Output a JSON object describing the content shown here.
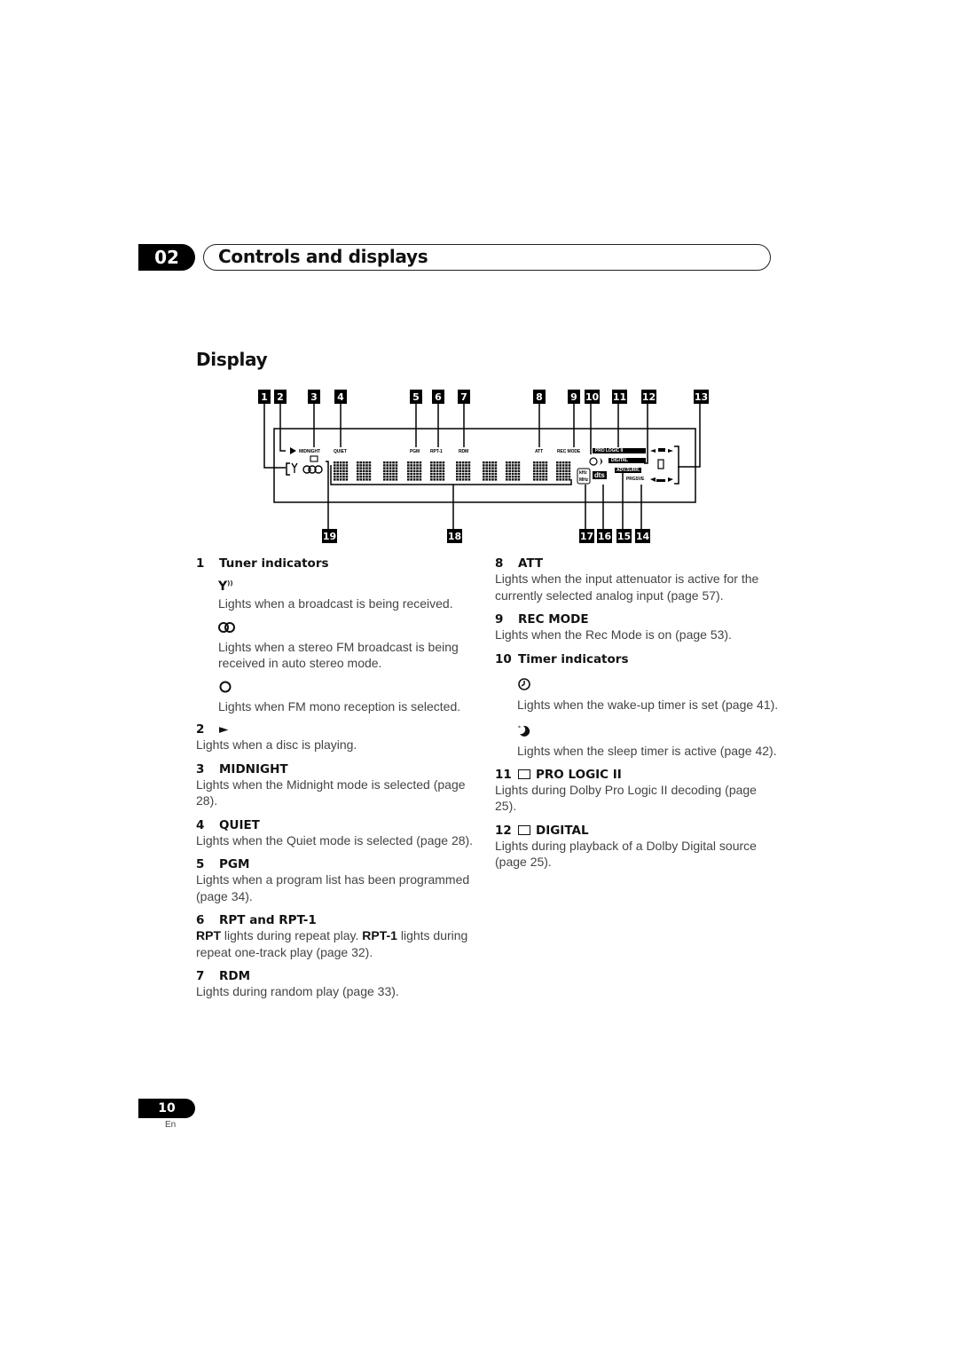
{
  "chapter": {
    "number": "02",
    "title": "Controls and displays"
  },
  "section_title": "Display",
  "diagram": {
    "top_callouts": [
      "1",
      "2",
      "3",
      "4",
      "5",
      "6",
      "7",
      "8",
      "9",
      "10",
      "11",
      "12",
      "13"
    ],
    "bottom_callouts": [
      "19",
      "18",
      "17",
      "16",
      "15",
      "14"
    ],
    "lcd_labels": {
      "midnight": "MIDNIGHT",
      "quiet": "QUIET",
      "pgm": "PGM",
      "rpt1": "RPT-1",
      "rdm": "RDM",
      "att": "ATT",
      "rec_mode": "REC MODE",
      "pro_logic": "PRO LOGIC II",
      "digital": "DIGITAL",
      "adv_surr": "ADV.SURR.",
      "prgsve": "PRGSVE",
      "khz": "kHz",
      "mhz": "MHz",
      "dts": "dts"
    },
    "icons": [
      "play-icon",
      "antenna-icon",
      "stereo-icon",
      "video-camera-icon",
      "clock-icon",
      "sleep-moon-icon",
      "dolby-icon",
      "speaker-layout-icon"
    ]
  },
  "items_left": [
    {
      "num": "1",
      "title": "Tuner indicators",
      "subitems": [
        {
          "icon": "antenna-icon",
          "glyph": "Y",
          "text": "Lights when a broadcast is being received."
        },
        {
          "icon": "stereo-icon",
          "glyph": "OO",
          "text": "Lights when a stereo FM broadcast is being received in auto stereo mode."
        },
        {
          "icon": "mono-icon",
          "glyph": "O",
          "text": "Lights when FM mono reception is selected."
        }
      ]
    },
    {
      "num": "2",
      "title": "►",
      "text": "Lights when a disc is playing."
    },
    {
      "num": "3",
      "title": "MIDNIGHT",
      "text": "Lights when the Midnight mode is selected (page 28)."
    },
    {
      "num": "4",
      "title": "QUIET",
      "text": "Lights when the Quiet mode is selected (page 28)."
    },
    {
      "num": "5",
      "title": "PGM",
      "text": "Lights when a program list has been programmed (page 34)."
    },
    {
      "num": "6",
      "title": "RPT and RPT-1",
      "text_bold1": "RPT",
      "text_mid": " lights during repeat play. ",
      "text_bold2": "RPT-1",
      "text_end": " lights during repeat one-track play (page 32)."
    },
    {
      "num": "7",
      "title": "RDM",
      "text": "Lights during random play (page 33)."
    }
  ],
  "items_right": [
    {
      "num": "8",
      "title": "ATT",
      "text": "Lights when the input attenuator is active for the currently selected analog input (page 57)."
    },
    {
      "num": "9",
      "title": "REC MODE",
      "text": "Lights when the Rec Mode is on (page 53)."
    },
    {
      "num": "10",
      "title": "Timer indicators",
      "subitems": [
        {
          "icon": "clock-icon",
          "text": "Lights when the wake-up timer is set (page 41)."
        },
        {
          "icon": "sleep-moon-icon",
          "text": "Lights when the sleep timer is active (page 42)."
        }
      ]
    },
    {
      "num": "11",
      "title": "PRO LOGIC II",
      "text": "Lights during Dolby Pro Logic II decoding (page 25)."
    },
    {
      "num": "12",
      "title": "DIGITAL",
      "text": "Lights during playback of a Dolby Digital source (page 25)."
    }
  ],
  "footer": {
    "page_number": "10",
    "language": "En"
  }
}
